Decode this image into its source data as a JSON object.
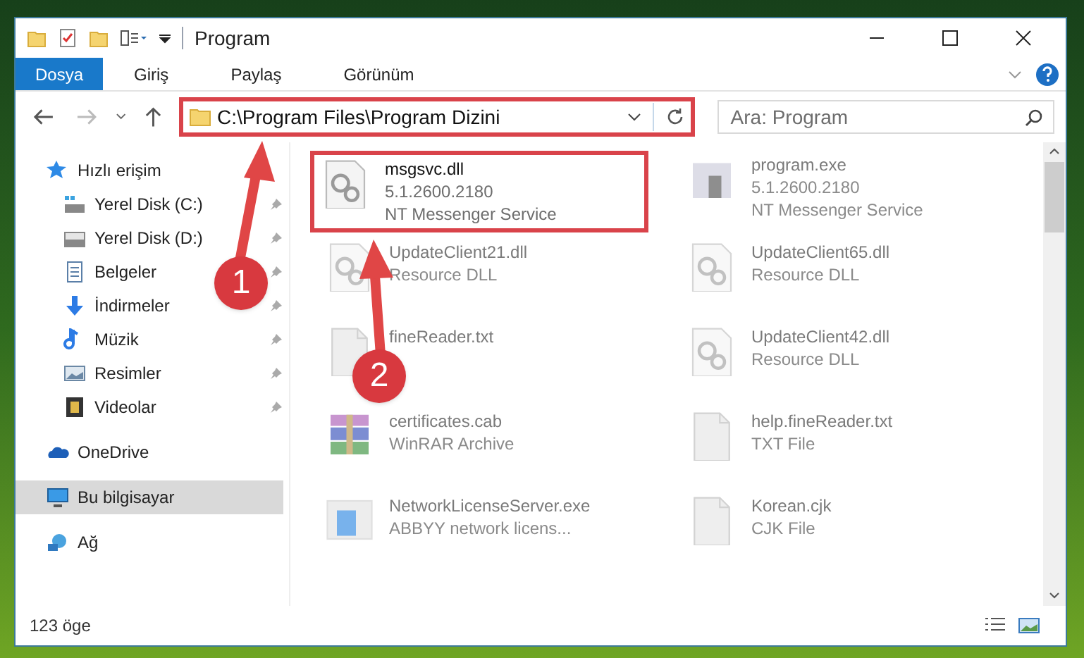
{
  "window": {
    "title": "Program"
  },
  "ribbon_tabs": [
    {
      "label": "Dosya",
      "selected": true
    },
    {
      "label": "Giriş",
      "selected": false
    },
    {
      "label": "Paylaş",
      "selected": false
    },
    {
      "label": "Görünüm",
      "selected": false
    }
  ],
  "address_bar": {
    "path": "C:\\Program Files\\Program Dizini",
    "highlighted": true
  },
  "search": {
    "placeholder": "Ara: Program"
  },
  "sidebar": {
    "items": [
      {
        "label": "Hızlı erişim",
        "kind": "group",
        "pinned": false,
        "selected": false
      },
      {
        "label": "Yerel Disk (C:)",
        "kind": "item",
        "pinned": true,
        "selected": false
      },
      {
        "label": "Yerel Disk (D:)",
        "kind": "item",
        "pinned": true,
        "selected": false
      },
      {
        "label": "Belgeler",
        "kind": "item",
        "pinned": true,
        "selected": false
      },
      {
        "label": "İndirmeler",
        "kind": "item",
        "pinned": true,
        "selected": false
      },
      {
        "label": "Müzik",
        "kind": "item",
        "pinned": true,
        "selected": false
      },
      {
        "label": "Resimler",
        "kind": "item",
        "pinned": true,
        "selected": false
      },
      {
        "label": "Videolar",
        "kind": "item",
        "pinned": true,
        "selected": false
      },
      {
        "label": "OneDrive",
        "kind": "group",
        "pinned": false,
        "selected": false
      },
      {
        "label": "Bu bilgisayar",
        "kind": "group",
        "pinned": false,
        "selected": true
      },
      {
        "label": "Ağ",
        "kind": "group",
        "pinned": false,
        "selected": false
      }
    ]
  },
  "files": [
    {
      "name": "msgsvc.dll",
      "lines": [
        "5.1.2600.2180",
        "NT Messenger Service"
      ],
      "kind": "dll",
      "faded": false,
      "highlighted": true
    },
    {
      "name": "program.exe",
      "lines": [
        "5.1.2600.2180",
        "NT Messenger Service"
      ],
      "kind": "exe",
      "faded": true,
      "highlighted": false
    },
    {
      "name": "UpdateClient21.dll",
      "lines": [
        "Resource DLL"
      ],
      "kind": "dll",
      "faded": true,
      "highlighted": false
    },
    {
      "name": "UpdateClient65.dll",
      "lines": [
        "Resource DLL"
      ],
      "kind": "dll",
      "faded": true,
      "highlighted": false
    },
    {
      "name": "fineReader.txt",
      "kind": "txt",
      "faded": true,
      "highlighted": false
    },
    {
      "name": "UpdateClient42.dll",
      "lines": [
        "Resource DLL"
      ],
      "kind": "dll",
      "faded": true,
      "highlighted": false
    },
    {
      "name": "certificates.cab",
      "lines": [
        "WinRAR Archive"
      ],
      "kind": "archive",
      "faded": true,
      "highlighted": false
    },
    {
      "name": "help.fineReader.txt",
      "lines": [
        "TXT File"
      ],
      "kind": "txt",
      "faded": true,
      "highlighted": false
    },
    {
      "name": "NetworkLicenseServer.exe",
      "lines": [
        "ABBYY network licens..."
      ],
      "kind": "app",
      "faded": true,
      "highlighted": false
    },
    {
      "name": "Korean.cjk",
      "lines": [
        "CJK File"
      ],
      "kind": "txt",
      "faded": true,
      "highlighted": false
    }
  ],
  "status_bar": {
    "item_count": "123 öge"
  },
  "annotations": [
    {
      "label": "1"
    },
    {
      "label": "2"
    }
  ]
}
